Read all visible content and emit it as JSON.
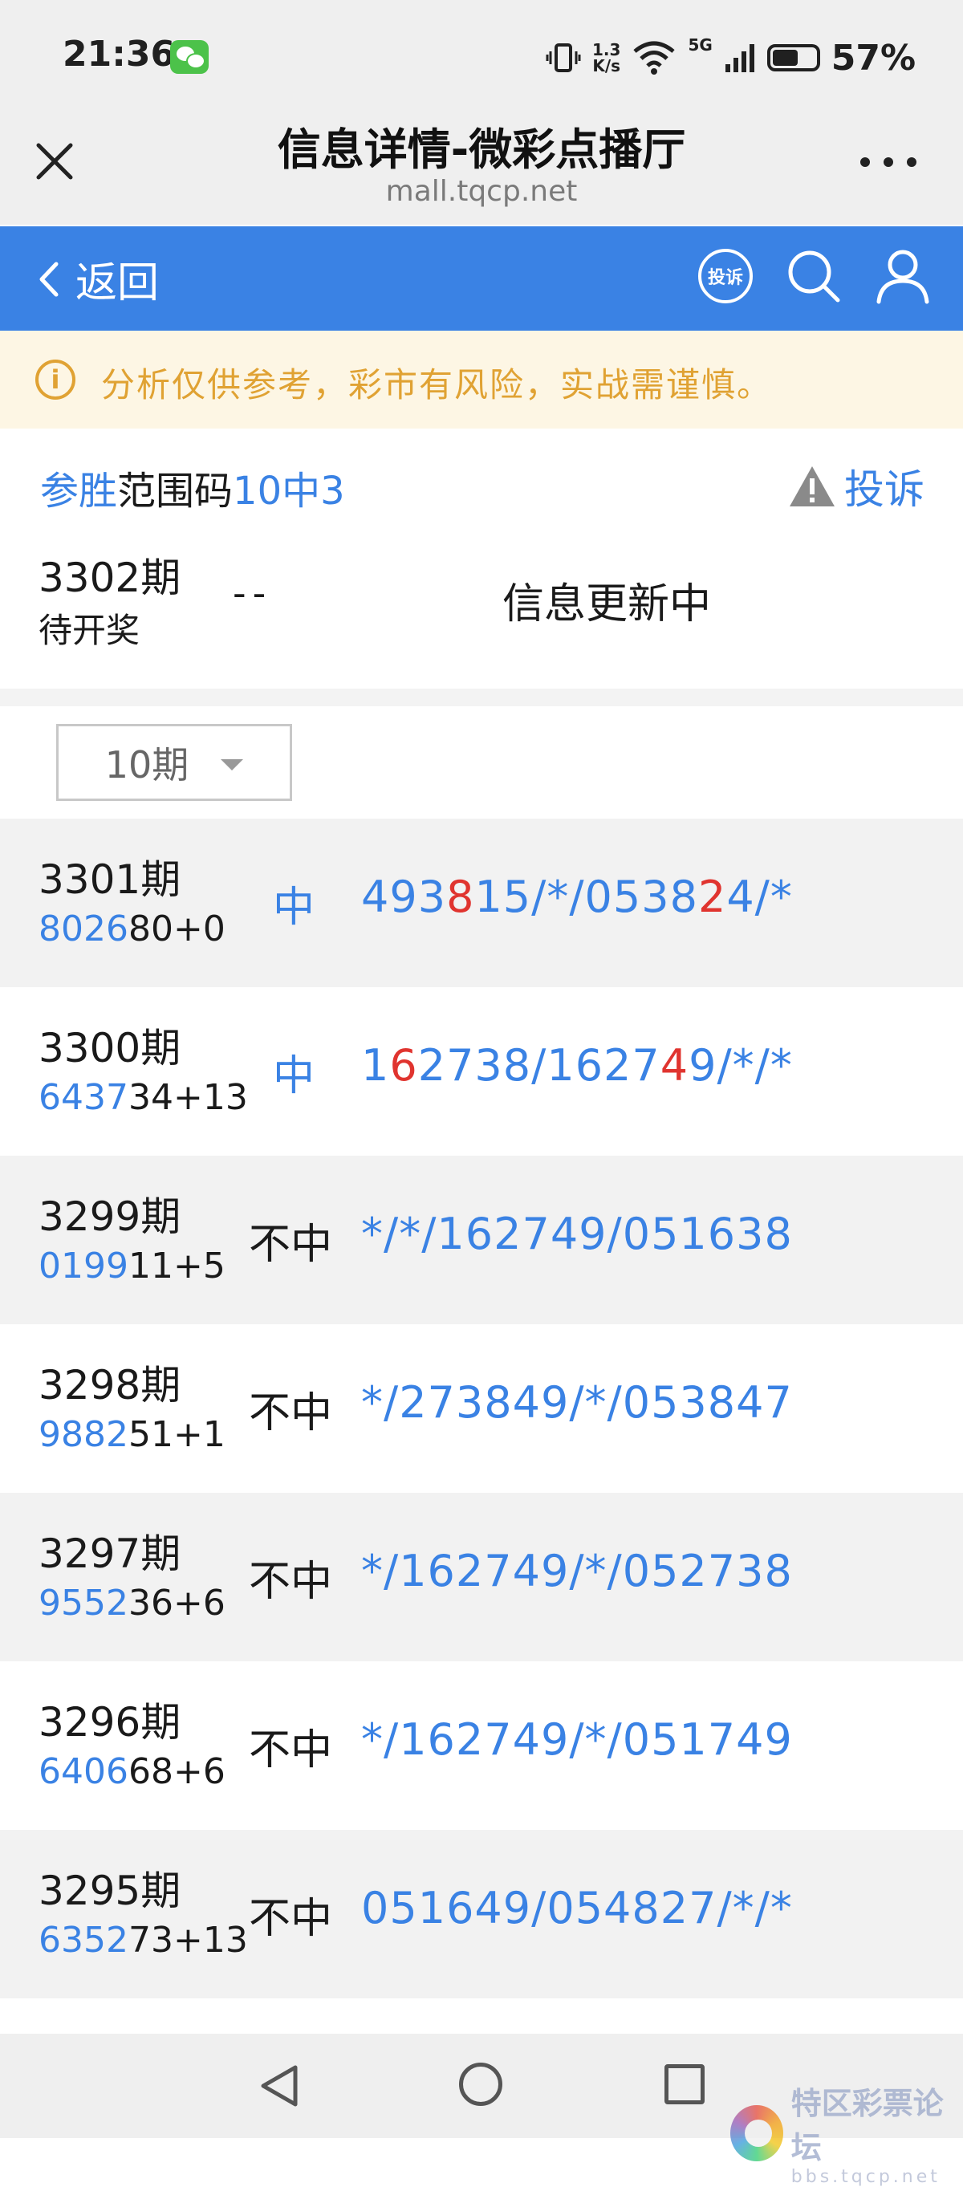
{
  "status_bar": {
    "time": "21:36",
    "net_speed_top": "1.3",
    "net_speed_bottom": "K/s",
    "signal_label": "5G",
    "battery_percent": "57%",
    "battery_level": 0.57
  },
  "browser": {
    "title": "信息详情-微彩点播厅",
    "url": "mall.tqcp.net"
  },
  "nav": {
    "back_label": "返回",
    "complaint_icon_label": "投诉"
  },
  "warning": {
    "text": "分析仅供参考，彩市有风险，实战需谨慎。"
  },
  "info": {
    "title_part1": "参胜",
    "title_part2": "范围码",
    "title_part3": "10中3",
    "report_label": "投诉",
    "current_issue": "3302期",
    "current_status": "待开奖",
    "current_dash": "--",
    "current_info": "信息更新中"
  },
  "period_selector": {
    "selected": "10期"
  },
  "records": [
    {
      "issue": "3301期",
      "code_head": "8026",
      "code_tail": "80+0",
      "result": "中",
      "nums": [
        {
          "t": "493"
        },
        {
          "t": "8",
          "hl": true
        },
        {
          "t": "15/*/0538"
        },
        {
          "t": "2",
          "hl": true
        },
        {
          "t": "4/*"
        }
      ]
    },
    {
      "issue": "3300期",
      "code_head": "6437",
      "code_tail": "34+13",
      "result": "中",
      "nums": [
        {
          "t": "1"
        },
        {
          "t": "6",
          "hl": true
        },
        {
          "t": "2738/1627"
        },
        {
          "t": "4",
          "hl": true
        },
        {
          "t": "9/*/*"
        }
      ]
    },
    {
      "issue": "3299期",
      "code_head": "0199",
      "code_tail": "11+5",
      "result": "不中",
      "nums": [
        {
          "t": "*/*/162749/051638"
        }
      ]
    },
    {
      "issue": "3298期",
      "code_head": "9882",
      "code_tail": "51+1",
      "result": "不中",
      "nums": [
        {
          "t": "*/273849/*/053847"
        }
      ]
    },
    {
      "issue": "3297期",
      "code_head": "9552",
      "code_tail": "36+6",
      "result": "不中",
      "nums": [
        {
          "t": "*/162749/*/052738"
        }
      ]
    },
    {
      "issue": "3296期",
      "code_head": "6406",
      "code_tail": "68+6",
      "result": "不中",
      "nums": [
        {
          "t": "*/162749/*/051749"
        }
      ]
    },
    {
      "issue": "3295期",
      "code_head": "6352",
      "code_tail": "73+13",
      "result": "不中",
      "nums": [
        {
          "t": "051649/054827/*/*"
        }
      ]
    }
  ],
  "watermark": {
    "main": "特区彩票论坛",
    "sub": "bbs.tqcp.net"
  },
  "colors": {
    "accent_blue": "#3a82e4",
    "highlight_red": "#e0342f",
    "warning_orange": "#e0a233"
  }
}
